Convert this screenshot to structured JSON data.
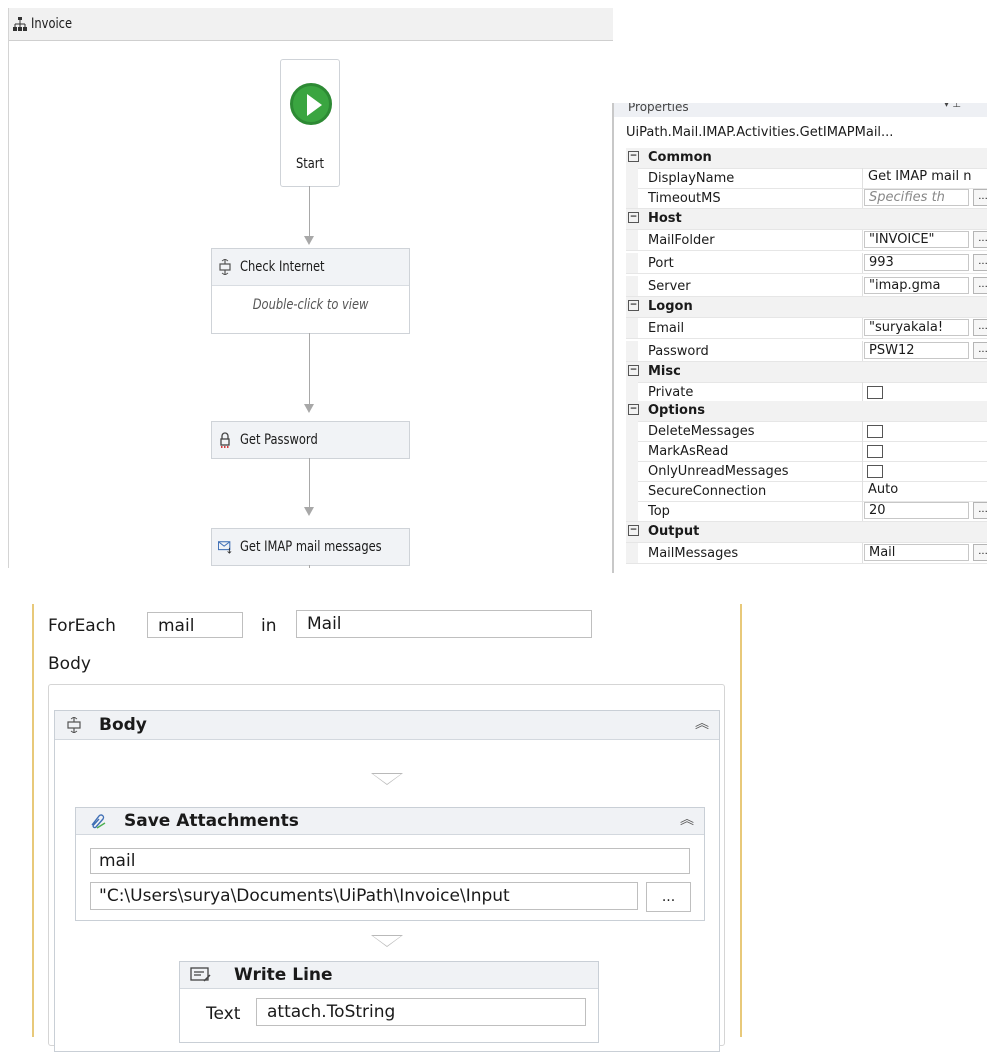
{
  "workflow": {
    "title": "Invoice",
    "start_label": "Start",
    "activities": [
      {
        "label": "Check Internet",
        "hint": "Double-click to view"
      },
      {
        "label": "Get Password"
      },
      {
        "label": "Get IMAP mail messages"
      }
    ]
  },
  "properties": {
    "panel_title": "Properties",
    "class_name": "UiPath.Mail.IMAP.Activities.GetIMAPMail...",
    "categories": {
      "common": "Common",
      "host": "Host",
      "logon": "Logon",
      "misc": "Misc",
      "options": "Options",
      "output": "Output"
    },
    "rows": {
      "display_name": {
        "name": "DisplayName",
        "value": "Get IMAP mail n"
      },
      "timeout": {
        "name": "TimeoutMS",
        "value": "Specifies th"
      },
      "mail_folder": {
        "name": "MailFolder",
        "value": "\"INVOICE\""
      },
      "port": {
        "name": "Port",
        "value": "993"
      },
      "server": {
        "name": "Server",
        "value": "\"imap.gma"
      },
      "email": {
        "name": "Email",
        "value": "\"suryakala!"
      },
      "password": {
        "name": "Password",
        "value": "PSW12"
      },
      "private": {
        "name": "Private"
      },
      "delete_messages": {
        "name": "DeleteMessages"
      },
      "mark_as_read": {
        "name": "MarkAsRead"
      },
      "only_unread": {
        "name": "OnlyUnreadMessages"
      },
      "secure_connection": {
        "name": "SecureConnection",
        "value": "Auto"
      },
      "top": {
        "name": "Top",
        "value": "20"
      },
      "mail_messages": {
        "name": "MailMessages",
        "value": "Mail"
      }
    },
    "ellipsis": "..."
  },
  "foreach": {
    "keyword": "ForEach",
    "variable": "mail",
    "in_keyword": "in",
    "collection": "Mail",
    "body_label": "Body",
    "sequence_label": "Body",
    "save_attachments": {
      "title": "Save Attachments",
      "message": "mail",
      "folder": "\"C:\\Users\\surya\\Documents\\UiPath\\Invoice\\Input",
      "ellipsis": "..."
    },
    "write_line": {
      "title": "Write Line",
      "text_label": "Text",
      "text_value": "attach.ToString"
    }
  },
  "colors": {
    "start_green": "#3aa540",
    "foreach_border": "#e8c97a"
  }
}
